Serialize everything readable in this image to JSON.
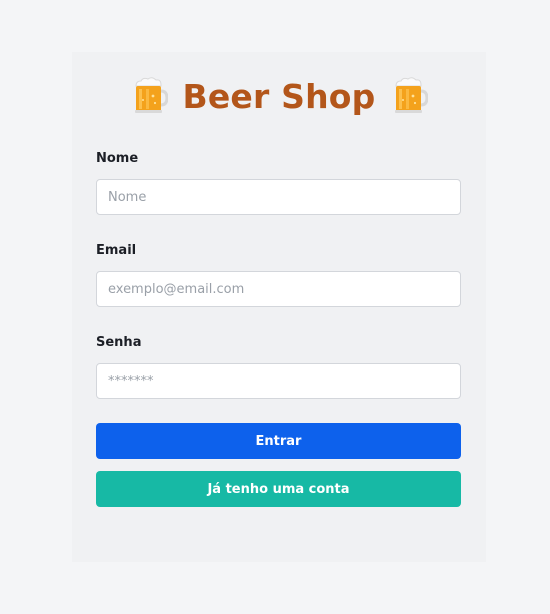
{
  "header": {
    "title": "Beer Shop",
    "left_icon": "beer-mug-icon",
    "right_icon": "beer-mug-icon"
  },
  "form": {
    "name": {
      "label": "Nome",
      "placeholder": "Nome",
      "value": ""
    },
    "email": {
      "label": "Email",
      "placeholder": "exemplo@email.com",
      "value": ""
    },
    "password": {
      "label": "Senha",
      "placeholder": "*******",
      "value": ""
    }
  },
  "buttons": {
    "submit_label": "Entrar",
    "login_label": "Já tenho uma conta"
  },
  "colors": {
    "title": "#b3561a",
    "primary_button": "#0d61ec",
    "secondary_button": "#17b9a5",
    "page_background": "#f4f5f7",
    "card_background": "#f0f1f3"
  }
}
